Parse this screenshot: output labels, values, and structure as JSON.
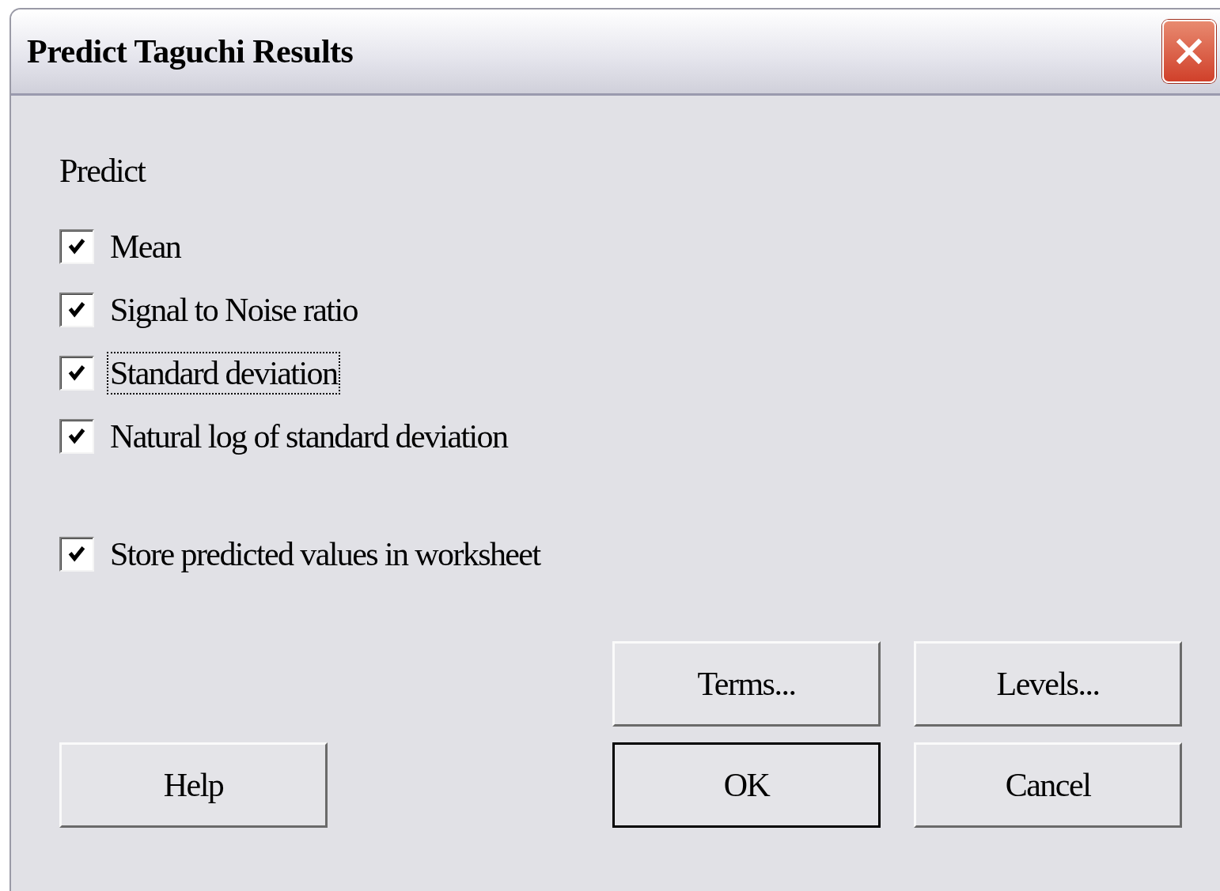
{
  "window": {
    "title": "Predict Taguchi Results"
  },
  "predict_label": "Predict",
  "options": [
    {
      "label": "Mean",
      "checked": true,
      "focused": false
    },
    {
      "label": "Signal to Noise ratio",
      "checked": true,
      "focused": false
    },
    {
      "label": "Standard deviation",
      "checked": true,
      "focused": true
    },
    {
      "label": "Natural log of standard deviation",
      "checked": true,
      "focused": false
    }
  ],
  "store_option": {
    "label": "Store predicted values in worksheet",
    "checked": true,
    "focused": false
  },
  "buttons": [
    {
      "label": "Terms...",
      "default": false
    },
    {
      "label": "Levels...",
      "default": false
    },
    {
      "label": "Help",
      "default": false
    },
    {
      "label": "OK",
      "default": true
    },
    {
      "label": "Cancel",
      "default": false
    }
  ]
}
